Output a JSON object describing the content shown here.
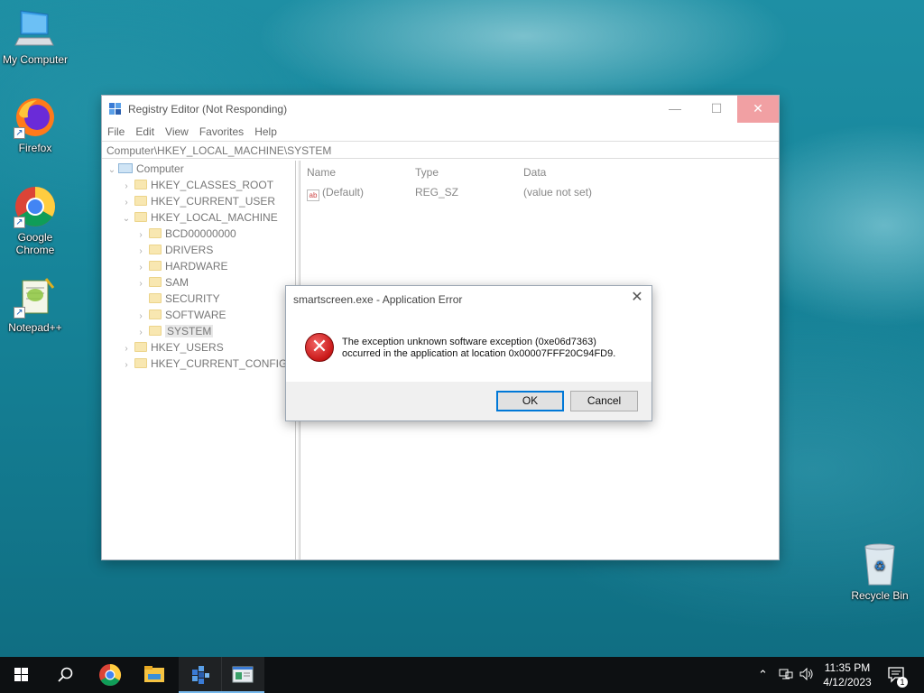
{
  "desktop": {
    "icons": [
      {
        "label": "My Computer",
        "icon": "computer-icon"
      },
      {
        "label": "Firefox",
        "icon": "firefox-icon"
      },
      {
        "label": "Google Chrome",
        "icon": "chrome-icon"
      },
      {
        "label": "Notepad++",
        "icon": "notepad-plus-plus-icon"
      },
      {
        "label": "Recycle Bin",
        "icon": "recycle-bin-icon"
      }
    ]
  },
  "regedit": {
    "title": "Registry Editor (Not Responding)",
    "menu": [
      "File",
      "Edit",
      "View",
      "Favorites",
      "Help"
    ],
    "address": "Computer\\HKEY_LOCAL_MACHINE\\SYSTEM",
    "tree": {
      "root": "Computer",
      "hives": [
        "HKEY_CLASSES_ROOT",
        "HKEY_CURRENT_USER",
        "HKEY_LOCAL_MACHINE",
        "HKEY_USERS",
        "HKEY_CURRENT_CONFIG"
      ],
      "hklm_children": [
        "BCD00000000",
        "DRIVERS",
        "HARDWARE",
        "SAM",
        "SECURITY",
        "SOFTWARE",
        "SYSTEM"
      ],
      "selected": "SYSTEM"
    },
    "columns": [
      "Name",
      "Type",
      "Data"
    ],
    "values": [
      {
        "name": "(Default)",
        "type": "REG_SZ",
        "data": "(value not set)"
      }
    ]
  },
  "dialog": {
    "title": "smartscreen.exe - Application Error",
    "message_line1": "The exception unknown software exception (0xe06d7363)",
    "message_line2": "occurred in the application at location 0x00007FFF20C94FD9.",
    "ok_label": "OK",
    "cancel_label": "Cancel",
    "icon": "error-icon"
  },
  "taskbar": {
    "time": "11:35 PM",
    "date": "4/12/2023",
    "notification_count": "1",
    "icons": [
      "start-icon",
      "search-icon",
      "chrome-icon",
      "file-explorer-icon",
      "regedit-icon",
      "app-window-icon"
    ],
    "tray": [
      "chevron-up-icon",
      "network-icon",
      "volume-icon",
      "action-center-icon"
    ]
  },
  "colors": {
    "accent": "#0078d7",
    "error_red": "#c91818",
    "close_hover": "#f1a0a3",
    "taskbar": "#0d1012"
  }
}
